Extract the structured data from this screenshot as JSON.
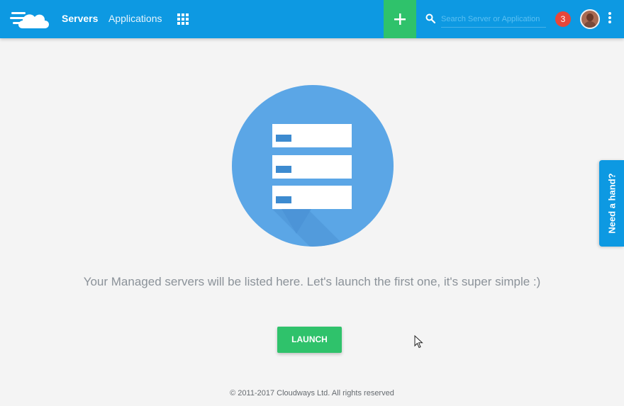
{
  "header": {
    "nav": [
      {
        "label": "Servers",
        "active": true
      },
      {
        "label": "Applications",
        "active": false
      }
    ],
    "search": {
      "placeholder": "Search Server or Application"
    },
    "notification_count": "3",
    "add_button_icon": "plus-icon",
    "apps_menu_icon": "grid-icon",
    "more_menu_icon": "kebab-icon"
  },
  "main": {
    "illustration": "server-stack-illustration",
    "message": "Your Managed servers will be listed here. Let's launch the first one, it's super simple :)",
    "launch_label": "LAUNCH"
  },
  "help_tab": {
    "label": "Need a hand?"
  },
  "footer": {
    "copyright": "© 2011-2017 Cloudways Ltd. All rights reserved"
  },
  "colors": {
    "brand_blue": "#0d99e2",
    "accent_green": "#2fc26b",
    "badge_red": "#e8463a",
    "illustration_blue": "#5ba6e6"
  }
}
